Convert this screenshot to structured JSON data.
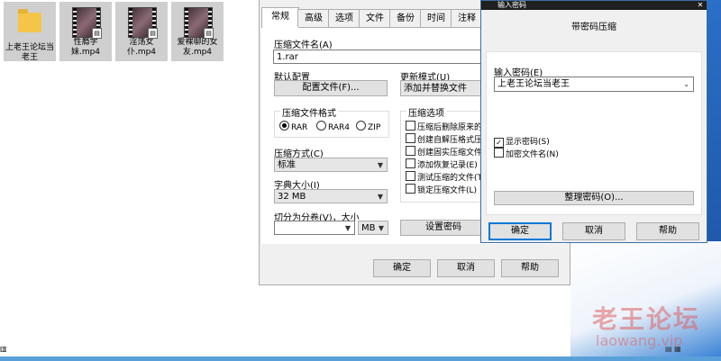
{
  "desktop": {
    "files": [
      {
        "label": "上老王论坛当老王",
        "icon": "folder-icon"
      },
      {
        "label": "性瘾学妹.mp4",
        "icon": "video-file-icon"
      },
      {
        "label": "淫荡女仆.mp4",
        "icon": "video-file-icon"
      },
      {
        "label": "爱裸聊的女友.mp4",
        "icon": "video-file-icon"
      }
    ],
    "watermark_cn": "老王论坛",
    "watermark_url": "laowang.vip"
  },
  "archive_dialog": {
    "tabs": [
      "常规",
      "高级",
      "选项",
      "文件",
      "备份",
      "时间",
      "注释"
    ],
    "active_tab": "常规",
    "archive_name_label": "压缩文件名(A)",
    "archive_name_value": "1.rar",
    "default_profile_label": "默认配置",
    "profile_button": "配置文件(F)...",
    "update_mode_label": "更新模式(U)",
    "update_mode_value": "添加并替换文件",
    "format_group_label": "压缩文件格式",
    "formats": [
      "RAR",
      "RAR4",
      "ZIP"
    ],
    "format_selected": "RAR",
    "options_group_label": "压缩选项",
    "options": [
      "压缩后删除原来的",
      "创建自解压格式压",
      "创建固实压缩文件",
      "添加恢复记录(E)",
      "测试压缩的文件(T",
      "锁定压缩文件(L)"
    ],
    "method_label": "压缩方式(C)",
    "method_value": "标准",
    "dict_label": "字典大小(I)",
    "dict_value": "32 MB",
    "split_label": "切分为分卷(V)，大小",
    "split_value": "",
    "split_unit": "MB",
    "set_password_button": "设置密码",
    "ok": "确定",
    "cancel": "取消",
    "help": "帮助"
  },
  "password_dialog": {
    "title": "输入密码",
    "header": "带密码压缩",
    "enter_password_label": "输入密码(E)",
    "password_value": "上老王论坛当老王",
    "show_password_label": "显示密码(S)",
    "show_password_checked": true,
    "encrypt_names_label": "加密文件名(N)",
    "encrypt_names_checked": false,
    "organize_button": "整理密码(O)...",
    "ok": "确定",
    "cancel": "取消",
    "help": "帮助"
  }
}
